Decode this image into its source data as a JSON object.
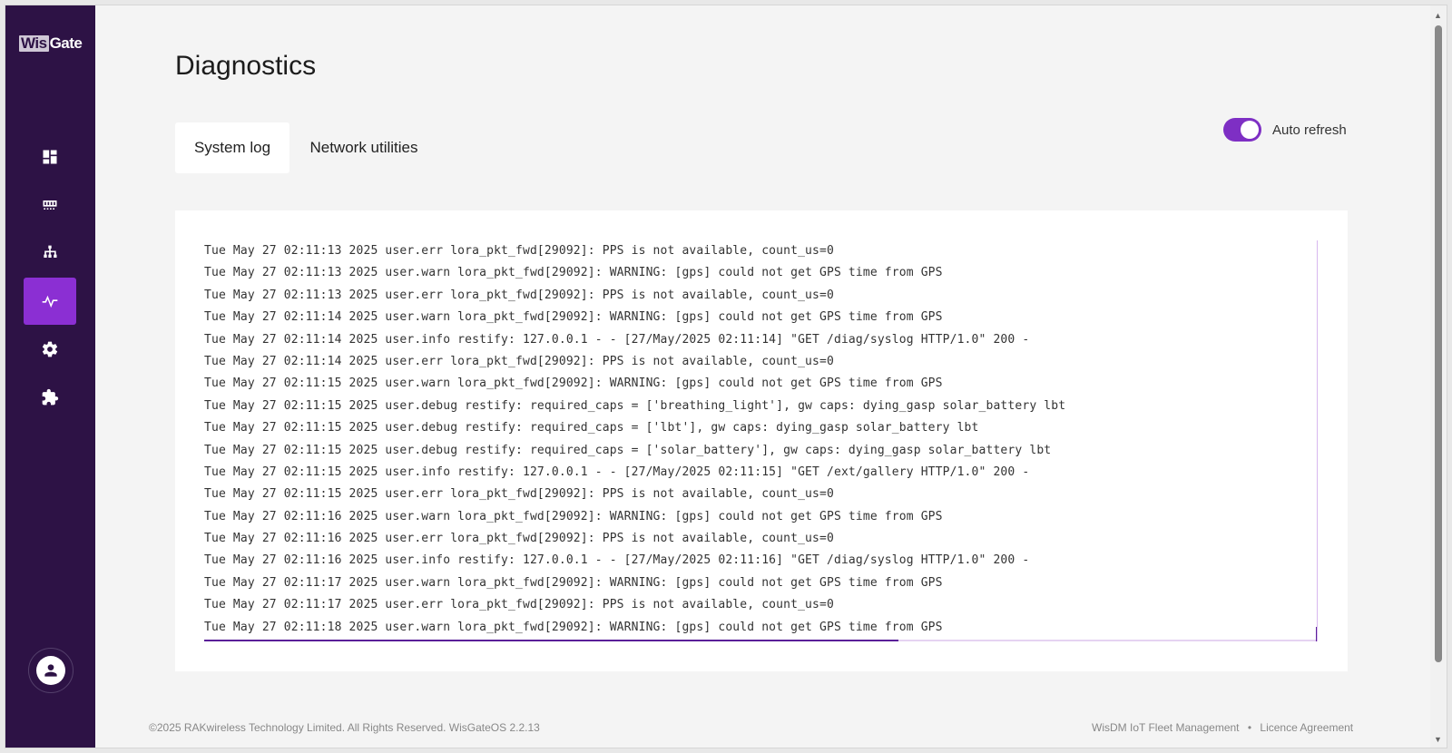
{
  "app": {
    "logo": {
      "part1": "Wis",
      "part2": "Gate"
    }
  },
  "sidebar": {
    "items": [
      {
        "name": "dashboard",
        "icon": "dashboard-icon",
        "active": false
      },
      {
        "name": "gateway",
        "icon": "gateway-icon",
        "active": false
      },
      {
        "name": "network",
        "icon": "network-icon",
        "active": false
      },
      {
        "name": "diagnostics",
        "icon": "activity-icon",
        "active": true
      },
      {
        "name": "settings",
        "icon": "gear-icon",
        "active": false
      },
      {
        "name": "extensions",
        "icon": "puzzle-icon",
        "active": false
      }
    ],
    "user_icon": "user-icon"
  },
  "page": {
    "title": "Diagnostics"
  },
  "tabs": [
    {
      "label": "System log",
      "active": true
    },
    {
      "label": "Network utilities",
      "active": false
    }
  ],
  "auto_refresh": {
    "label": "Auto refresh",
    "enabled": true
  },
  "log": {
    "lines": [
      "Tue May 27 02:11:13 2025 user.err lora_pkt_fwd[29092]: PPS is not available, count_us=0",
      "Tue May 27 02:11:13 2025 user.warn lora_pkt_fwd[29092]: WARNING: [gps] could not get GPS time from GPS",
      "Tue May 27 02:11:13 2025 user.err lora_pkt_fwd[29092]: PPS is not available, count_us=0",
      "Tue May 27 02:11:14 2025 user.warn lora_pkt_fwd[29092]: WARNING: [gps] could not get GPS time from GPS",
      "Tue May 27 02:11:14 2025 user.info restify: 127.0.0.1 - - [27/May/2025 02:11:14] \"GET /diag/syslog HTTP/1.0\" 200 -",
      "Tue May 27 02:11:14 2025 user.err lora_pkt_fwd[29092]: PPS is not available, count_us=0",
      "Tue May 27 02:11:15 2025 user.warn lora_pkt_fwd[29092]: WARNING: [gps] could not get GPS time from GPS",
      "Tue May 27 02:11:15 2025 user.debug restify: required_caps = ['breathing_light'], gw caps: dying_gasp solar_battery lbt",
      "Tue May 27 02:11:15 2025 user.debug restify: required_caps = ['lbt'], gw caps: dying_gasp solar_battery lbt",
      "Tue May 27 02:11:15 2025 user.debug restify: required_caps = ['solar_battery'], gw caps: dying_gasp solar_battery lbt",
      "Tue May 27 02:11:15 2025 user.info restify: 127.0.0.1 - - [27/May/2025 02:11:15] \"GET /ext/gallery HTTP/1.0\" 200 -",
      "Tue May 27 02:11:15 2025 user.err lora_pkt_fwd[29092]: PPS is not available, count_us=0",
      "Tue May 27 02:11:16 2025 user.warn lora_pkt_fwd[29092]: WARNING: [gps] could not get GPS time from GPS",
      "Tue May 27 02:11:16 2025 user.err lora_pkt_fwd[29092]: PPS is not available, count_us=0",
      "Tue May 27 02:11:16 2025 user.info restify: 127.0.0.1 - - [27/May/2025 02:11:16] \"GET /diag/syslog HTTP/1.0\" 200 -",
      "Tue May 27 02:11:17 2025 user.warn lora_pkt_fwd[29092]: WARNING: [gps] could not get GPS time from GPS",
      "Tue May 27 02:11:17 2025 user.err lora_pkt_fwd[29092]: PPS is not available, count_us=0",
      "Tue May 27 02:11:18 2025 user.warn lora_pkt_fwd[29092]: WARNING: [gps] could not get GPS time from GPS"
    ]
  },
  "footer": {
    "copyright": "©2025 RAKwireless Technology Limited. All Rights Reserved. WisGateOS 2.2.13",
    "fleet_link": "WisDM IoT Fleet Management",
    "separator": "•",
    "licence_link": "Licence Agreement"
  },
  "colors": {
    "sidebar_bg": "#2d1245",
    "accent": "#8b2fd3",
    "toggle_on": "#7e2fc4"
  }
}
